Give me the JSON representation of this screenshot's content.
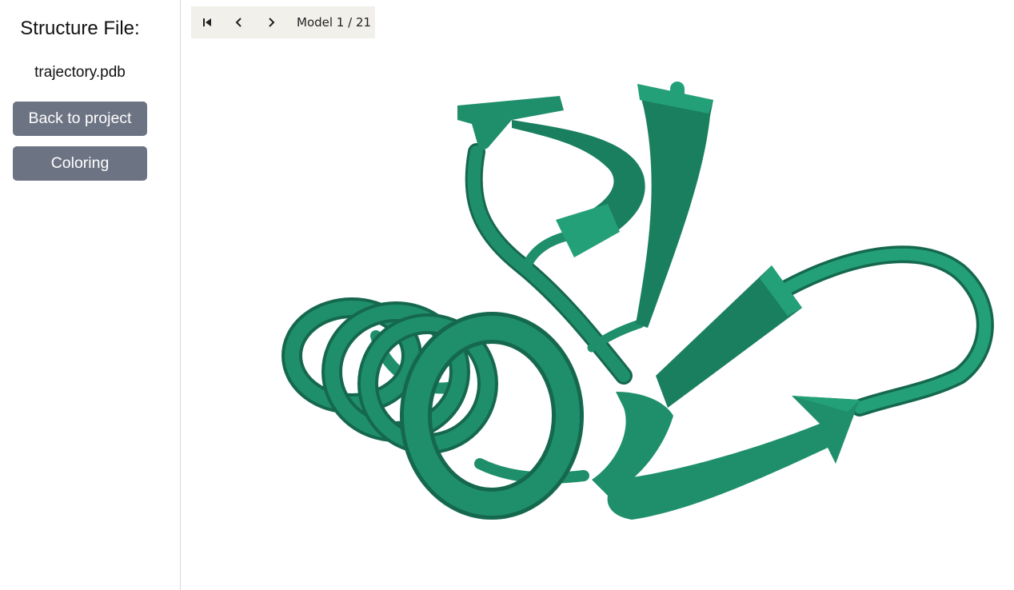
{
  "sidebar": {
    "title": "Structure File:",
    "file_name": "trajectory.pdb",
    "back_label": "Back to project",
    "coloring_label": "Coloring"
  },
  "viewer": {
    "toolbar": {
      "first_icon": "skip-to-first-icon",
      "prev_icon": "chevron-left-icon",
      "next_icon": "chevron-right-icon",
      "model_label": "Model 1 / 21"
    },
    "structure": {
      "representation": "cartoon ribbon",
      "color": "#1f8f6b",
      "shade_color": "#15684e",
      "highlight_color": "#2aa97f"
    }
  },
  "colors": {
    "button_bg": "#6c7383",
    "toolbar_bg": "#f1f0eb",
    "divider": "#d9d9d9"
  }
}
